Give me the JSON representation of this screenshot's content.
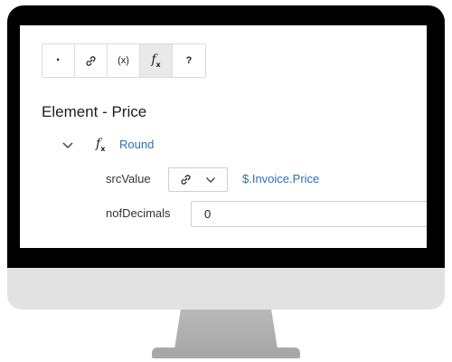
{
  "toolbar": {
    "buttons": [
      {
        "label": "·",
        "icon": "dot-icon"
      },
      {
        "label": "",
        "icon": "link-icon"
      },
      {
        "label": "(x)",
        "icon": "variable-icon"
      },
      {
        "label": "f",
        "sub": "x",
        "icon": "function-icon",
        "active": true
      },
      {
        "label": "?",
        "icon": "help-icon"
      }
    ]
  },
  "element": {
    "title": "Element - Price"
  },
  "function": {
    "name": "Round",
    "params": {
      "src": {
        "label": "srcValue",
        "value": "$.Invoice.Price",
        "mode_icon": "link-icon"
      },
      "nof": {
        "label": "nofDecimals",
        "value": "0"
      }
    }
  },
  "colors": {
    "link": "#2d6fb7",
    "active_button": "#e9e9e9",
    "bezel": "#000000",
    "chin": "#e2e2e2"
  }
}
